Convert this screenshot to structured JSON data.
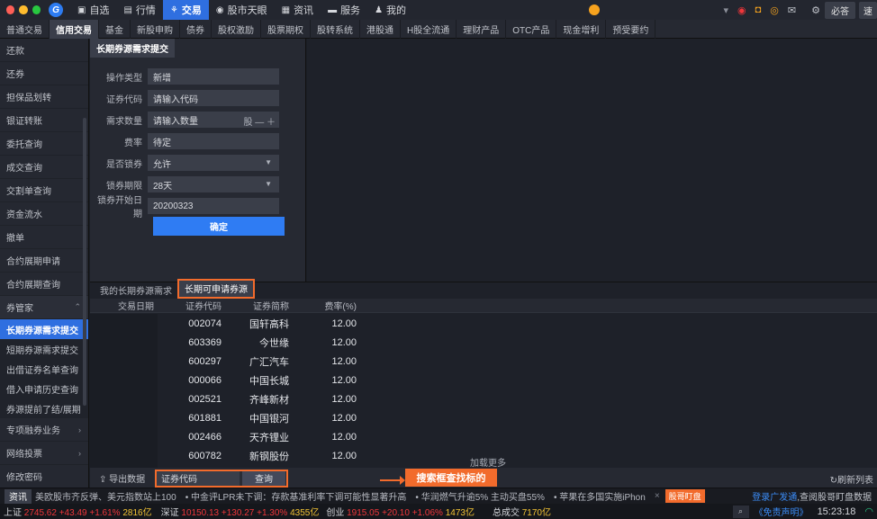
{
  "topnav": {
    "items": [
      {
        "icon": "grid-icon",
        "glyph": "▣",
        "label": "自选"
      },
      {
        "icon": "chart-icon",
        "glyph": "▤",
        "label": "行情"
      },
      {
        "icon": "trade-icon",
        "glyph": "⚘",
        "label": "交易",
        "active": true
      },
      {
        "icon": "eye-icon",
        "glyph": "◉",
        "label": "股市天眼"
      },
      {
        "icon": "news-icon",
        "glyph": "▦",
        "label": "资讯"
      },
      {
        "icon": "briefcase-icon",
        "glyph": "▬",
        "label": "服务"
      },
      {
        "icon": "user-icon",
        "glyph": "♟",
        "label": "我的"
      }
    ],
    "right": {
      "bidu": "必答",
      "su": "速"
    }
  },
  "subtabs": [
    "普通交易",
    "信用交易",
    "基金",
    "新股申购",
    "债券",
    "股权激励",
    "股票期权",
    "股转系统",
    "港股通",
    "H股全流通",
    "理财产品",
    "OTC产品",
    "现金增利",
    "预受要约"
  ],
  "subtabs_active": 1,
  "sidebar": {
    "items": [
      "还款",
      "还券",
      "担保品划转",
      "银证转账",
      "委托查询",
      "成交查询",
      "交割单查询",
      "资金流水",
      "撤单",
      "合约展期申请",
      "合约展期查询"
    ],
    "group": "券管家",
    "subitems": [
      "长期券源需求提交",
      "短期券源需求提交",
      "出借证券名单查询",
      "借入申请历史查询",
      "券源提前了结/展期"
    ],
    "bottom": [
      "专项融券业务",
      "网络投票",
      "修改密码"
    ]
  },
  "form": {
    "title": "长期券源需求提交",
    "rows": [
      {
        "label": "操作类型",
        "value": "新增"
      },
      {
        "label": "证券代码",
        "value": "请输入代码"
      },
      {
        "label": "需求数量",
        "value": "请输入数量",
        "unit": "股 — ＋"
      },
      {
        "label": "费率",
        "value": "待定"
      },
      {
        "label": "是否锁券",
        "value": "允许",
        "dropdown": true
      },
      {
        "label": "锁券期限",
        "value": "28天",
        "dropdown": true
      },
      {
        "label": "锁券开始日期",
        "value": "20200323"
      }
    ],
    "confirm": "确定"
  },
  "list": {
    "tabs": [
      "我的长期券源需求",
      "长期可申请券源"
    ],
    "active_tab": 1,
    "columns": [
      "交易日期",
      "证券代码",
      "证券简称",
      "费率(%)"
    ],
    "rows": [
      [
        "",
        "002074",
        "国轩高科",
        "12.00"
      ],
      [
        "",
        "603369",
        "今世缘",
        "12.00"
      ],
      [
        "",
        "600297",
        "广汇汽车",
        "12.00"
      ],
      [
        "",
        "000066",
        "中国长城",
        "12.00"
      ],
      [
        "",
        "002521",
        "齐峰新材",
        "12.00"
      ],
      [
        "",
        "601881",
        "中国银河",
        "12.00"
      ],
      [
        "",
        "002466",
        "天齐锂业",
        "12.00"
      ],
      [
        "",
        "600782",
        "新钢股份",
        "12.00"
      ]
    ],
    "load_more": "加载更多",
    "export": "导出数据",
    "search_placeholder": "证券代码",
    "search_button": "查询",
    "callout": "搜索框查找标的",
    "refresh": "刷新列表"
  },
  "news": {
    "tag": "资讯",
    "items": [
      "美欧股市齐反弹、美元指数站上100",
      "中金评LPR未下调：存款基准利率下调可能性显著升高",
      "华润燃气升逾5% 主动买盘55%",
      "苹果在多国实施iPhon"
    ],
    "badge": "股哥盯盘",
    "right_blue": "登录广发通",
    "right_text": ",查阅股哥盯盘数据"
  },
  "market": {
    "sh": {
      "name": "上证",
      "price": "2745.62",
      "chg": "+43.49",
      "pct": "+1.61%",
      "vol": "2816亿"
    },
    "sz": {
      "name": "深证",
      "price": "10150.13",
      "chg": "+130.27",
      "pct": "+1.30%",
      "vol": "4355亿"
    },
    "cy": {
      "name": "创业",
      "price": "1915.05",
      "chg": "+20.10",
      "pct": "+1.06%",
      "vol": "1473亿"
    },
    "total_label": "总成交",
    "total": "7170亿",
    "free": "《免责声明》",
    "clock": "15:23:18"
  },
  "colors": {
    "accent": "#2f6fe0",
    "highlight": "#f26b2c",
    "up": "#f0363a"
  }
}
